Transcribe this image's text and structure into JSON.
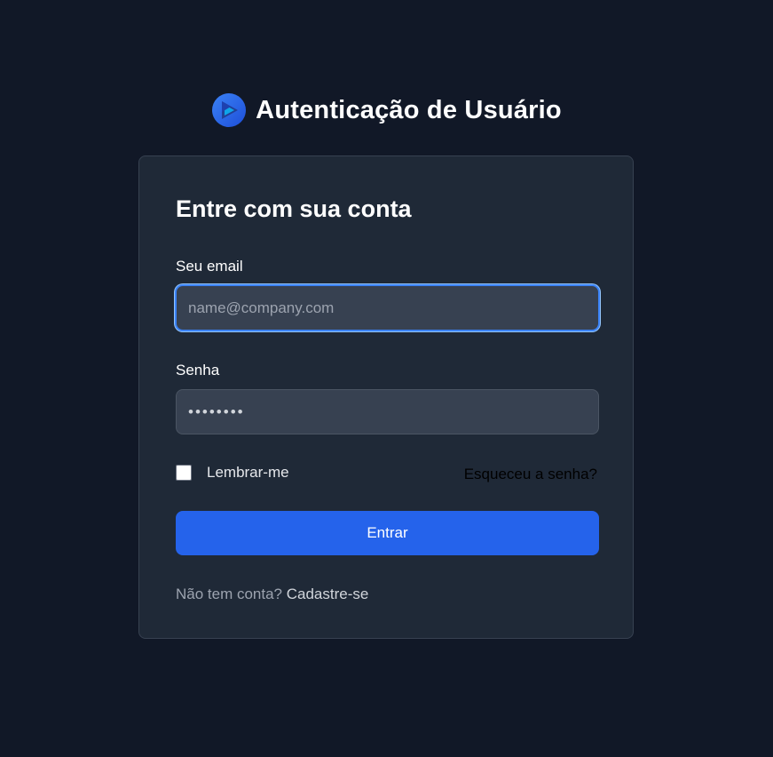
{
  "app": {
    "title": "Autenticação de Usuário",
    "logo_icon": "play-circle-logo-icon"
  },
  "login": {
    "heading": "Entre com sua conta",
    "email_label": "Seu email",
    "email_placeholder": "name@company.com",
    "email_value": "",
    "password_label": "Senha",
    "password_value": "••••••••",
    "remember_label": "Lembrar-me",
    "remember_checked": false,
    "forgot_link": "Esqueceu a senha?",
    "submit_label": "Entrar",
    "signup_prompt": "Não tem conta?",
    "signup_link": "Cadastre-se"
  },
  "colors": {
    "background": "#111827",
    "card": "#1f2937",
    "input": "#374151",
    "accent": "#2563eb",
    "focus_ring": "#3b82f6"
  }
}
